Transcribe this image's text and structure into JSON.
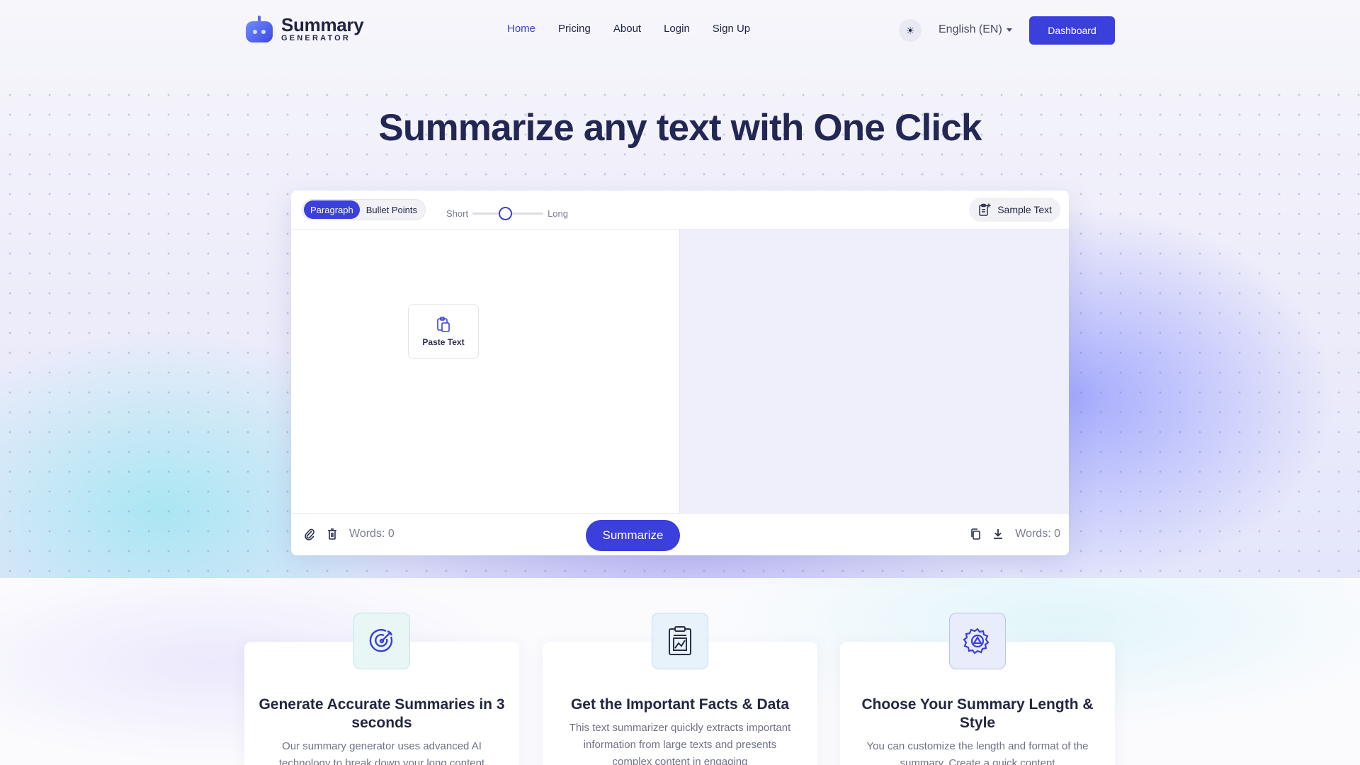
{
  "brand": {
    "name": "Summary",
    "subtitle": "GENERATOR"
  },
  "nav": [
    {
      "label": "Home"
    },
    {
      "label": "Pricing"
    },
    {
      "label": "About"
    },
    {
      "label": "Login"
    },
    {
      "label": "Sign Up"
    }
  ],
  "header": {
    "language": "English (EN)",
    "dashboard_label": "Dashboard",
    "theme_icon": "sun-icon"
  },
  "hero": {
    "title": "Summarize any text with One Click"
  },
  "editor": {
    "modes": [
      "Paragraph",
      "Bullet Points"
    ],
    "active_mode": "Paragraph",
    "length_short": "Short",
    "length_long": "Long",
    "length_level": 0.45,
    "sample_label": "Sample Text",
    "paste_label": "Paste Text",
    "input_words": "Words: 0",
    "output_words": "Words: 0",
    "summarize_label": "Summarize"
  },
  "features": [
    {
      "title": "Generate Accurate Summaries in 3 seconds",
      "text": "Our summary generator uses advanced AI technology to break down your long content",
      "icon": "target-icon"
    },
    {
      "title": "Get the Important Facts & Data",
      "text": "This text summarizer quickly extracts important information from large texts and presents complex content in engaging",
      "icon": "clipboard-chart-icon"
    },
    {
      "title": "Choose Your Summary Length & Style",
      "text": "You can customize the length and format of the summary. Create a quick content",
      "icon": "gear-icon"
    }
  ],
  "colors": {
    "accent": "#3b3fdc",
    "title": "#232754",
    "output_pane": "#efeffb"
  }
}
